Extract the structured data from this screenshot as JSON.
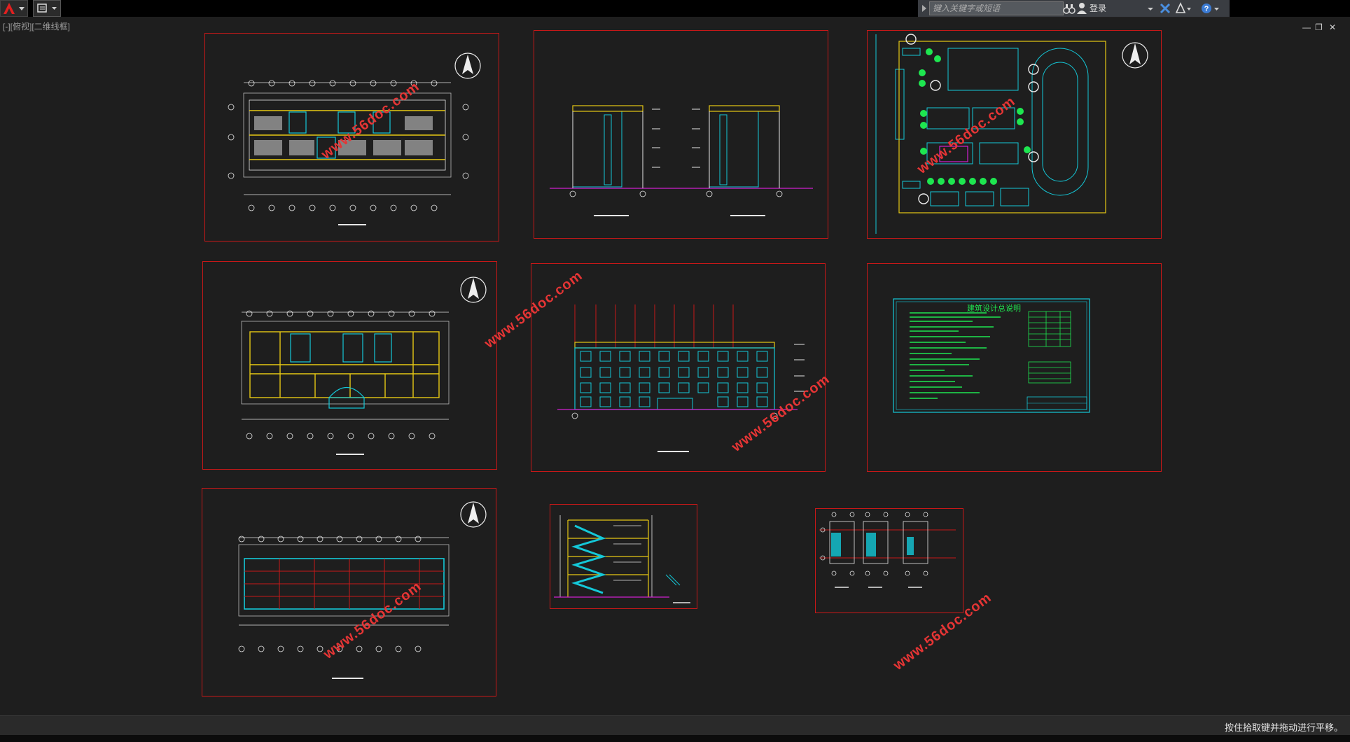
{
  "toolbar": {
    "search_placeholder": "键入关键字或短语",
    "login_label": "登录"
  },
  "viewport": {
    "label": "[-][俯视][二维线框]"
  },
  "sheets": {
    "general_notes_title": "建筑设计总说明"
  },
  "watermark": "www.56doc.com",
  "status": {
    "text": "按住拾取键并拖动进行平移。"
  },
  "colors": {
    "frame": "#c81818",
    "cyan": "#14c8d8",
    "yellow": "#e6c814",
    "green": "#1ee650",
    "magenta": "#d020d0",
    "watermark": "#e63535"
  }
}
